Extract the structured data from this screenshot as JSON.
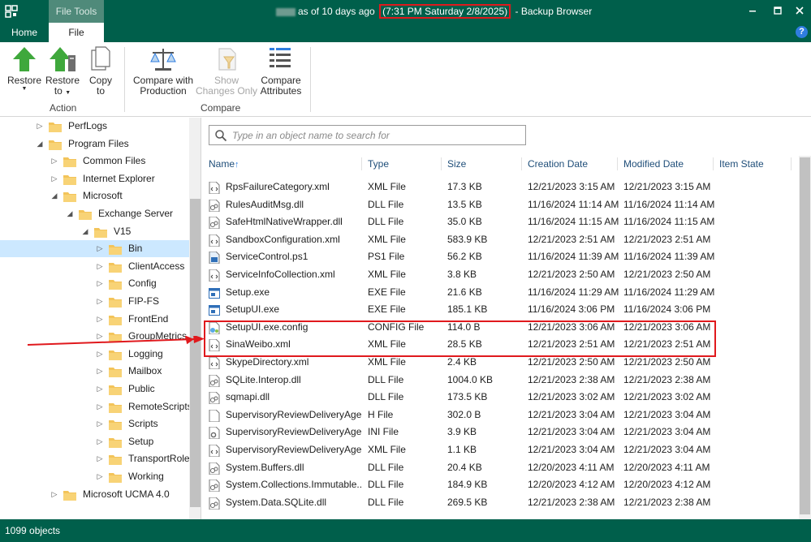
{
  "titlebar": {
    "tab_label": "File Tools",
    "title_prefix": "as of 10 days ago",
    "title_date": "(7:31 PM Saturday 2/8/2025)",
    "title_suffix": "- Backup Browser"
  },
  "tabs": {
    "home": "Home",
    "file": "File",
    "help": "?"
  },
  "ribbon": {
    "restore": "Restore",
    "restore_to_1": "Restore",
    "restore_to_2": "to",
    "copy_to_1": "Copy",
    "copy_to_2": "to",
    "compare_production_1": "Compare with",
    "compare_production_2": "Production",
    "show_changes_1": "Show",
    "show_changes_2": "Changes Only",
    "compare_attributes_1": "Compare",
    "compare_attributes_2": "Attributes",
    "group_action": "Action",
    "group_compare": "Compare"
  },
  "tree": [
    {
      "label": "PerfLogs",
      "level": 2,
      "expander": "collapsed"
    },
    {
      "label": "Program Files",
      "level": 2,
      "expander": "expanded"
    },
    {
      "label": "Common Files",
      "level": 3,
      "expander": "collapsed"
    },
    {
      "label": "Internet Explorer",
      "level": 3,
      "expander": "collapsed"
    },
    {
      "label": "Microsoft",
      "level": 3,
      "expander": "expanded"
    },
    {
      "label": "Exchange Server",
      "level": 4,
      "expander": "expanded"
    },
    {
      "label": "V15",
      "level": 5,
      "expander": "expanded"
    },
    {
      "label": "Bin",
      "level": 6,
      "expander": "collapsed",
      "selected": true
    },
    {
      "label": "ClientAccess",
      "level": 6,
      "expander": "collapsed"
    },
    {
      "label": "Config",
      "level": 6,
      "expander": "collapsed"
    },
    {
      "label": "FIP-FS",
      "level": 6,
      "expander": "collapsed"
    },
    {
      "label": "FrontEnd",
      "level": 6,
      "expander": "collapsed"
    },
    {
      "label": "GroupMetrics",
      "level": 6,
      "expander": "collapsed"
    },
    {
      "label": "Logging",
      "level": 6,
      "expander": "collapsed"
    },
    {
      "label": "Mailbox",
      "level": 6,
      "expander": "collapsed"
    },
    {
      "label": "Public",
      "level": 6,
      "expander": "collapsed"
    },
    {
      "label": "RemoteScripts",
      "level": 6,
      "expander": "collapsed"
    },
    {
      "label": "Scripts",
      "level": 6,
      "expander": "collapsed"
    },
    {
      "label": "Setup",
      "level": 6,
      "expander": "collapsed"
    },
    {
      "label": "TransportRoles",
      "level": 6,
      "expander": "collapsed"
    },
    {
      "label": "Working",
      "level": 6,
      "expander": "collapsed"
    },
    {
      "label": "Microsoft UCMA 4.0",
      "level": 3,
      "expander": "collapsed"
    }
  ],
  "search": {
    "placeholder": "Type in an object name to search for",
    "value": ""
  },
  "columns": {
    "name": "Name",
    "sort_indicator": "↑",
    "type": "Type",
    "size": "Size",
    "created": "Creation Date",
    "modified": "Modified Date",
    "state": "Item State"
  },
  "files": [
    {
      "name": "RpsFailureCategory.xml",
      "type": "XML File",
      "size": "17.3 KB",
      "created": "12/21/2023 3:15 AM",
      "modified": "12/21/2023 3:15 AM",
      "icon": "xml-file-icon"
    },
    {
      "name": "RulesAuditMsg.dll",
      "type": "DLL File",
      "size": "13.5 KB",
      "created": "11/16/2024 11:14 AM",
      "modified": "11/16/2024 11:14 AM",
      "icon": "dll-file-icon"
    },
    {
      "name": "SafeHtmlNativeWrapper.dll",
      "type": "DLL File",
      "size": "35.0 KB",
      "created": "11/16/2024 11:15 AM",
      "modified": "11/16/2024 11:15 AM",
      "icon": "dll-file-icon"
    },
    {
      "name": "SandboxConfiguration.xml",
      "type": "XML File",
      "size": "583.9 KB",
      "created": "12/21/2023 2:51 AM",
      "modified": "12/21/2023 2:51 AM",
      "icon": "xml-file-icon"
    },
    {
      "name": "ServiceControl.ps1",
      "type": "PS1 File",
      "size": "56.2 KB",
      "created": "11/16/2024 11:39 AM",
      "modified": "11/16/2024 11:39 AM",
      "icon": "ps1-file-icon"
    },
    {
      "name": "ServiceInfoCollection.xml",
      "type": "XML File",
      "size": "3.8 KB",
      "created": "12/21/2023 2:50 AM",
      "modified": "12/21/2023 2:50 AM",
      "icon": "xml-file-icon"
    },
    {
      "name": "Setup.exe",
      "type": "EXE File",
      "size": "21.6 KB",
      "created": "11/16/2024 11:29 AM",
      "modified": "11/16/2024 11:29 AM",
      "icon": "exe-file-icon"
    },
    {
      "name": "SetupUI.exe",
      "type": "EXE File",
      "size": "185.1 KB",
      "created": "11/16/2024 3:06 PM",
      "modified": "11/16/2024 3:06 PM",
      "icon": "exe-file-icon"
    },
    {
      "name": "SetupUI.exe.config",
      "type": "CONFIG File",
      "size": "114.0 B",
      "created": "12/21/2023 3:06 AM",
      "modified": "12/21/2023 3:06 AM",
      "icon": "config-file-icon"
    },
    {
      "name": "SinaWeibo.xml",
      "type": "XML File",
      "size": "28.5 KB",
      "created": "12/21/2023 2:51 AM",
      "modified": "12/21/2023 2:51 AM",
      "icon": "xml-file-icon"
    },
    {
      "name": "SkypeDirectory.xml",
      "type": "XML File",
      "size": "2.4 KB",
      "created": "12/21/2023 2:50 AM",
      "modified": "12/21/2023 2:50 AM",
      "icon": "xml-file-icon"
    },
    {
      "name": "SQLite.Interop.dll",
      "type": "DLL File",
      "size": "1004.0 KB",
      "created": "12/21/2023 2:38 AM",
      "modified": "12/21/2023 2:38 AM",
      "icon": "dll-file-icon"
    },
    {
      "name": "sqmapi.dll",
      "type": "DLL File",
      "size": "173.5 KB",
      "created": "12/21/2023 3:02 AM",
      "modified": "12/21/2023 3:02 AM",
      "icon": "dll-file-icon"
    },
    {
      "name": "SupervisoryReviewDeliveryAge...",
      "type": "H File",
      "size": "302.0 B",
      "created": "12/21/2023 3:04 AM",
      "modified": "12/21/2023 3:04 AM",
      "icon": "h-file-icon"
    },
    {
      "name": "SupervisoryReviewDeliveryAge...",
      "type": "INI File",
      "size": "3.9 KB",
      "created": "12/21/2023 3:04 AM",
      "modified": "12/21/2023 3:04 AM",
      "icon": "ini-file-icon"
    },
    {
      "name": "SupervisoryReviewDeliveryAge...",
      "type": "XML File",
      "size": "1.1 KB",
      "created": "12/21/2023 3:04 AM",
      "modified": "12/21/2023 3:04 AM",
      "icon": "xml-file-icon"
    },
    {
      "name": "System.Buffers.dll",
      "type": "DLL File",
      "size": "20.4 KB",
      "created": "12/20/2023 4:11 AM",
      "modified": "12/20/2023 4:11 AM",
      "icon": "dll-file-icon"
    },
    {
      "name": "System.Collections.Immutable...",
      "type": "DLL File",
      "size": "184.9 KB",
      "created": "12/20/2023 4:12 AM",
      "modified": "12/20/2023 4:12 AM",
      "icon": "dll-file-icon"
    },
    {
      "name": "System.Data.SQLite.dll",
      "type": "DLL File",
      "size": "269.5 KB",
      "created": "12/21/2023 2:38 AM",
      "modified": "12/21/2023 2:38 AM",
      "icon": "dll-file-icon"
    }
  ],
  "status": {
    "count": "1099 objects"
  },
  "colors": {
    "accent": "#005f4b",
    "highlight": "#e0191d",
    "selection": "#cce8ff"
  }
}
